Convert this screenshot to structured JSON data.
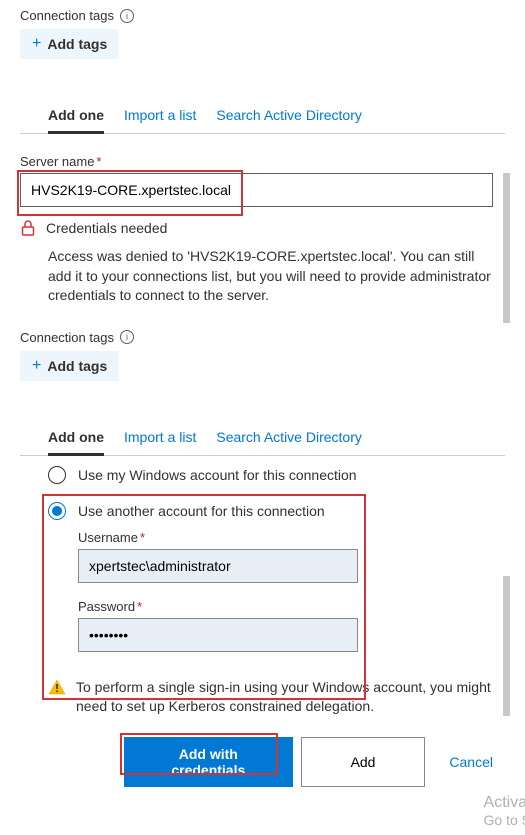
{
  "section1": {
    "connection_tags_label": "Connection tags",
    "add_tags_label": "Add tags"
  },
  "tabs": {
    "add_one": "Add one",
    "import": "Import a list",
    "search_ad": "Search Active Directory"
  },
  "server": {
    "label": "Server name",
    "value": "HVS2K19-CORE.xpertstec.local",
    "cred_needed": "Credentials needed",
    "cred_desc": "Access was denied to 'HVS2K19-CORE.xpertstec.local'. You can still add it to your connections list, but you will need to provide administrator credentials to connect to the server."
  },
  "auth": {
    "use_windows": "Use my Windows account for this connection",
    "use_another": "Use another account for this connection",
    "username_label": "Username",
    "username_value": "xpertstec\\administrator",
    "password_label": "Password",
    "password_value": "••••••••"
  },
  "warning": "To perform a single sign-in using your Windows account, you might need to set up Kerberos constrained delegation.",
  "buttons": {
    "add_with_credentials": "Add with credentials",
    "add": "Add",
    "cancel": "Cancel"
  },
  "watermark": {
    "line1": "Activa",
    "line2": "Go to S"
  }
}
